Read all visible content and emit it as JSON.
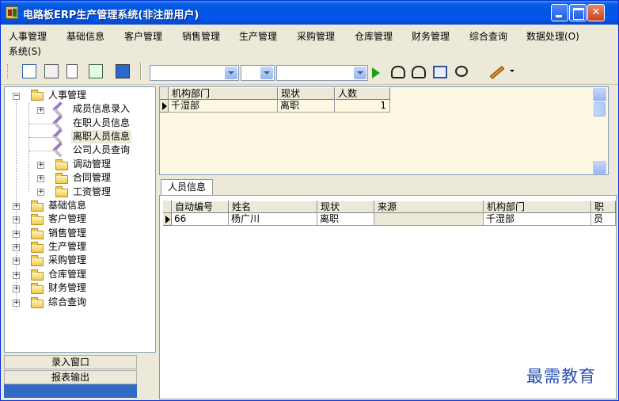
{
  "window": {
    "title": "电路板ERP生产管理系统(非注册用户)"
  },
  "menu": {
    "row1": [
      "人事管理",
      "基础信息",
      "客户管理",
      "销售管理",
      "生产管理",
      "采购管理",
      "仓库管理",
      "财务管理",
      "综合查询",
      "数据处理(O)"
    ],
    "row2": [
      "系统(S)"
    ]
  },
  "toolbar": {
    "icons": [
      "org-chart-icon",
      "card-icon",
      "document-icon",
      "chart-window-icon",
      "monitor-icon"
    ],
    "right_icons": [
      "binoculars-icon",
      "binoculars-icon",
      "zoom-page-icon",
      "refresh-icon",
      "pencil-icon"
    ]
  },
  "tree": {
    "root": "人事管理",
    "children": [
      "成员信息录入",
      "在职人员信息",
      "离职人员信息",
      "公司人员查询",
      "调动管理",
      "合同管理",
      "工资管理"
    ],
    "selected": "离职人员信息",
    "top_level": [
      "基础信息",
      "客户管理",
      "销售管理",
      "生产管理",
      "采购管理",
      "仓库管理",
      "财务管理",
      "综合查询"
    ]
  },
  "left_buttons": {
    "entry": "录入窗口",
    "report": "报表输出"
  },
  "top_grid": {
    "headers": [
      "机构部门",
      "现状",
      "人数"
    ],
    "rows": [
      [
        "千湿部",
        "离职",
        "1"
      ]
    ]
  },
  "tab": {
    "label": "人员信息"
  },
  "bottom_grid": {
    "headers": [
      "自动编号",
      "姓名",
      "现状",
      "来源",
      "机构部门",
      "职"
    ],
    "rows": [
      [
        "66",
        "杨广川",
        "离职",
        "",
        "千湿部",
        "员"
      ]
    ]
  },
  "watermark": "最需教育"
}
